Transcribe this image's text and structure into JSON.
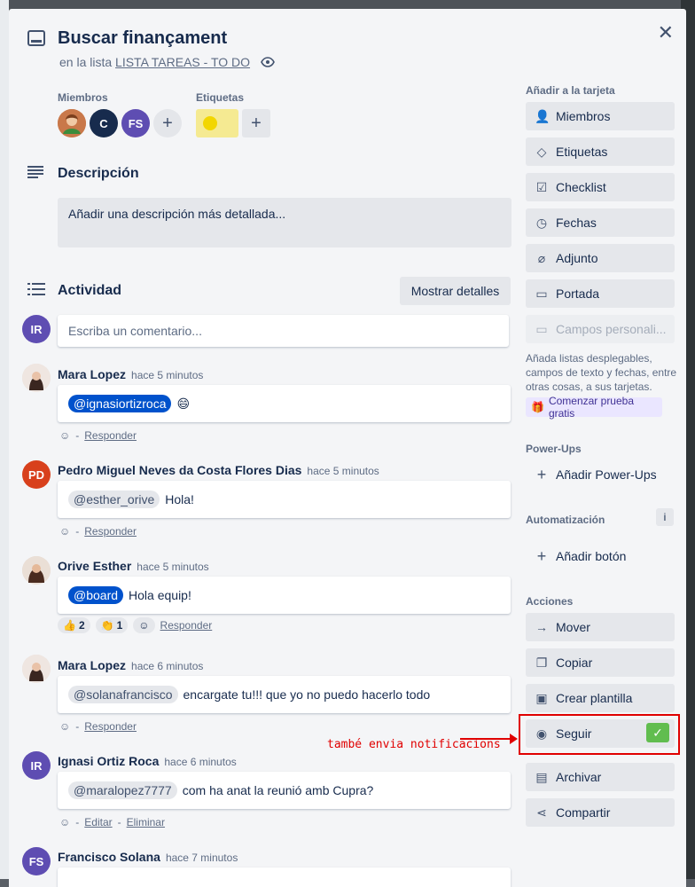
{
  "card": {
    "title": "Buscar finançament",
    "in_list_prefix": "en la lista",
    "list_name": "LISTA TAREAS - TO DO"
  },
  "members": {
    "heading": "Miembros",
    "avatars": [
      {
        "initials": "",
        "color": "#d08a5a"
      },
      {
        "initials": "C",
        "color": "#172b4d"
      },
      {
        "initials": "FS",
        "color": "#5e4db2"
      }
    ]
  },
  "labels": {
    "heading": "Etiquetas",
    "label_color": "#f2d600"
  },
  "description": {
    "heading": "Descripción",
    "placeholder": "Añadir una descripción más detallada..."
  },
  "activity": {
    "heading": "Actividad",
    "show_details": "Mostrar detalles",
    "current_user_initials": "IR",
    "comment_placeholder": "Escriba un comentario..."
  },
  "comments": [
    {
      "author": "Mara Lopez",
      "time": "hace 5 minutos",
      "mention": "@ignasiortizroca",
      "text": "😄",
      "actions": [
        "Responder"
      ]
    },
    {
      "author": "Pedro Miguel Neves da Costa Flores Dias",
      "initials": "PD",
      "time": "hace 5 minutos",
      "mention": "@esther_orive",
      "text": "Hola!",
      "actions": [
        "Responder"
      ]
    },
    {
      "author": "Orive Esther",
      "time": "hace 5 minutos",
      "mention": "@board",
      "text": "Hola equip!",
      "reactions": [
        {
          "emoji": "👍",
          "count": "2"
        },
        {
          "emoji": "👏",
          "count": "1"
        }
      ],
      "actions": [
        "Responder"
      ]
    },
    {
      "author": "Mara Lopez",
      "time": "hace 6 minutos",
      "mention": "@solanafrancisco",
      "text": "encargate tu!!! que yo no puedo hacerlo todo",
      "actions": [
        "Responder"
      ]
    },
    {
      "author": "Ignasi Ortiz Roca",
      "initials": "IR",
      "time": "hace 6 minutos",
      "mention": "@maralopez7777",
      "text": "com ha anat la reunió amb Cupra?",
      "actions": [
        "Editar",
        "Eliminar"
      ]
    },
    {
      "author": "Francisco Solana",
      "initials": "FS",
      "time": "hace 7 minutos"
    }
  ],
  "sidebar": {
    "add_heading": "Añadir a la tarjeta",
    "add_items": [
      "Miembros",
      "Etiquetas",
      "Checklist",
      "Fechas",
      "Adjunto",
      "Portada",
      "Campos personali..."
    ],
    "hint": "Añada listas desplegables, campos de texto y fechas, entre otras cosas, a sus tarjetas.",
    "trial_button": "Comenzar prueba gratis",
    "powerups_heading": "Power-Ups",
    "powerups_add": "Añadir Power-Ups",
    "automation_heading": "Automatización",
    "automation_add": "Añadir botón",
    "actions_heading": "Acciones",
    "actions": [
      "Mover",
      "Copiar",
      "Crear plantilla",
      "Seguir",
      "Archivar",
      "Compartir"
    ]
  },
  "annotation": {
    "text": "també envia notificacions",
    "color": "#e00000"
  }
}
